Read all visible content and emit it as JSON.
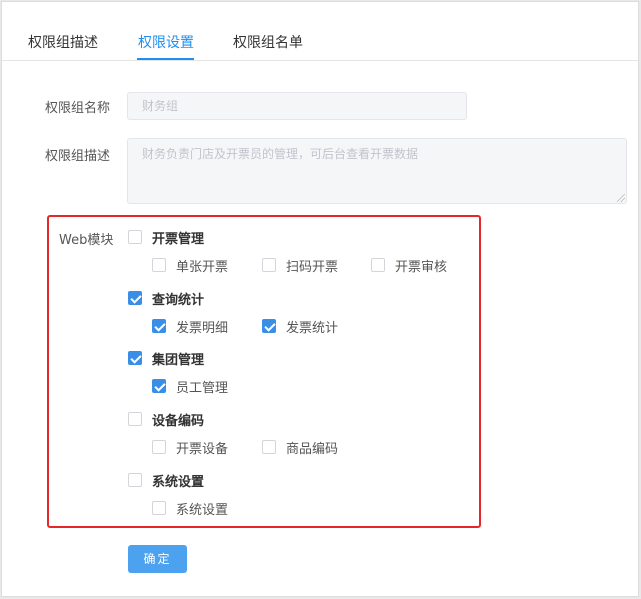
{
  "tabs": [
    {
      "label": "权限组描述",
      "active": false
    },
    {
      "label": "权限设置",
      "active": true
    },
    {
      "label": "权限组名单",
      "active": false
    }
  ],
  "form": {
    "name_label": "权限组名称",
    "name_placeholder": "财务组",
    "desc_label": "权限组描述",
    "desc_placeholder": "财务负责门店及开票员的管理，可后台查看开票数据",
    "module_label": "Web模块"
  },
  "modules": [
    {
      "title": "开票管理",
      "checked": false,
      "items": [
        {
          "label": "单张开票",
          "checked": false
        },
        {
          "label": "扫码开票",
          "checked": false
        },
        {
          "label": "开票审核",
          "checked": false
        }
      ]
    },
    {
      "title": "查询统计",
      "checked": true,
      "items": [
        {
          "label": "发票明细",
          "checked": true
        },
        {
          "label": "发票统计",
          "checked": true
        }
      ]
    },
    {
      "title": "集团管理",
      "checked": true,
      "items": [
        {
          "label": "员工管理",
          "checked": true
        }
      ]
    },
    {
      "title": "设备编码",
      "checked": false,
      "items": [
        {
          "label": "开票设备",
          "checked": false
        },
        {
          "label": "商品编码",
          "checked": false
        }
      ]
    },
    {
      "title": "系统设置",
      "checked": false,
      "items": [
        {
          "label": "系统设置",
          "checked": false
        }
      ]
    }
  ],
  "submit_label": "确定",
  "colors": {
    "accent": "#1f8ef1",
    "highlight_border": "#e52727",
    "button": "#4da2f0"
  }
}
